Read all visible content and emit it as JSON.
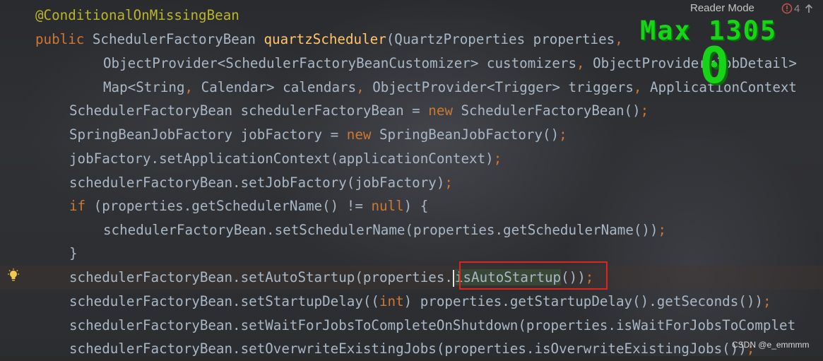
{
  "header": {
    "reader_mode": "Reader Mode",
    "problems_count": "4",
    "icons": [
      "error-icon",
      "arrow-up-icon"
    ]
  },
  "overlay": {
    "max_label": "Max 1305",
    "counter": "0"
  },
  "code": {
    "l1_annotation": "@ConditionalOnMissingBean",
    "l2_kw": "public",
    "l2_type": " SchedulerFactoryBean ",
    "l2_fn": "quartzScheduler",
    "l2_rest": "(QuartzProperties properties",
    "l2_comma": ",",
    "l3_a": "ObjectProvider<SchedulerFactoryBeanCustomizer> customizers",
    "l3_comma": ",",
    "l3_b": " ObjectProvider<JobDetail>",
    "l4_a": "Map<String",
    "l4_c1": ",",
    "l4_b": " Calendar> calendars",
    "l4_c2": ",",
    "l4_c": " ObjectProvider<Trigger> triggers",
    "l4_c3": ",",
    "l4_d": " ApplicationContext",
    "l5_a": "SchedulerFactoryBean schedulerFactoryBean = ",
    "l5_kw": "new",
    "l5_b": " SchedulerFactoryBean()",
    "l5_semi": ";",
    "l6_a": "SpringBeanJobFactory jobFactory = ",
    "l6_kw": "new",
    "l6_b": " SpringBeanJobFactory()",
    "l6_semi": ";",
    "l7_a": "jobFactory.setApplicationContext(applicationContext)",
    "l7_semi": ";",
    "l8_a": "schedulerFactoryBean.setJobFactory(jobFactory)",
    "l8_semi": ";",
    "l9_kw": "if",
    "l9_a": " (properties.getSchedulerName() != ",
    "l9_null": "null",
    "l9_b": ") {",
    "l10_a": "schedulerFactoryBean.setSchedulerName(properties.getSchedulerName())",
    "l10_semi": ";",
    "l11_a": "}",
    "l12_a": "schedulerFactoryBean.setAutoStartup(properties.",
    "l12_hl": "isAutoStartup",
    "l12_b": "())",
    "l12_semi": ";",
    "l13_a": "schedulerFactoryBean.setStartupDelay((",
    "l13_kw": "int",
    "l13_b": ") properties.getStartupDelay().getSeconds())",
    "l13_semi": ";",
    "l14_a": "schedulerFactoryBean.setWaitForJobsToCompleteOnShutdown(properties.isWaitForJobsToComplet",
    "l15_a": "schedulerFactoryBean.setOverwriteExistingJobs(properties.isOverwriteExistingJobs())",
    "l15_semi": ";"
  },
  "watermark": "CSDN @e_emmmm",
  "colors": {
    "background": "#2b2b2b",
    "keyword": "#cc7832",
    "method_decl": "#ffc66d",
    "annotation": "#bbb529",
    "text": "#a9b7c6",
    "highlight_box": "#e0231e",
    "overlay_green": "#18d418"
  }
}
